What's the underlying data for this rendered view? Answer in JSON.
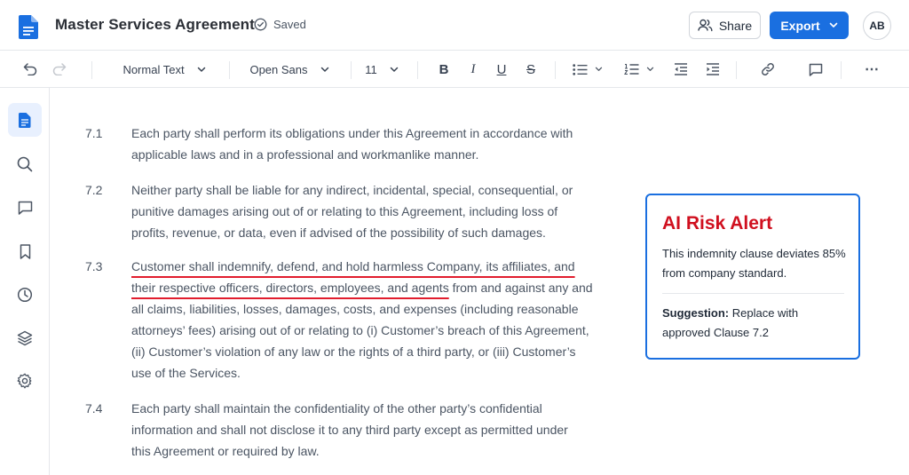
{
  "header": {
    "doc_title": "Master Services Agreement",
    "saved_label": "Saved",
    "share_label": "Share",
    "export_label": "Export",
    "avatar_initials": "AB"
  },
  "toolbar": {
    "style_select": "Normal Text",
    "font_select": "Open Sans",
    "size_select": "11",
    "bold": "B",
    "italic": "I",
    "underline": "U",
    "strike": "S",
    "more": "⋯"
  },
  "sidebar": {
    "items": [
      "document-icon",
      "search-icon",
      "comment-icon",
      "bookmark-icon",
      "history-icon",
      "layers-icon",
      "gear-icon"
    ]
  },
  "clauses": [
    {
      "number": "7.1",
      "lines": [
        "Each party shall perform its obligations under this Agreement in accordance with",
        "applicable laws and in a professional and workmanlike manner."
      ]
    },
    {
      "number": "7.2",
      "lines": [
        "Neither party shall be liable for any indirect, incidental, special, consequential, or",
        "punitive damages arising out of or relating to this Agreement, including loss of",
        "profits, revenue, or data, even if advised of the possibility of such damages."
      ]
    },
    {
      "number": "7.3",
      "flagged_line1": "Customer shall indemnify, defend, and hold harmless Company, its affiliates, and",
      "flagged_line2": "their respective officers, directors, employees, and agents",
      "line2_rest": " from and against any and",
      "lines": [
        "all claims, liabilities, losses, damages, costs, and expenses (including reasonable",
        "attorneys’ fees) arising out of or relating to (i) Customer’s breach of this Agreement,",
        "(ii) Customer’s violation of any law or the rights of a third party, or (iii) Customer’s",
        "use of the Services."
      ]
    },
    {
      "number": "7.4",
      "lines": [
        "Each party shall maintain the confidentiality of the other party’s confidential",
        "information and shall not disclose it to any third party except as permitted under",
        "this Agreement or required by law."
      ]
    }
  ],
  "alert": {
    "title": "AI Risk Alert",
    "message": "This indemnity clause deviates 85% from company standard.",
    "suggestion_label": "Suggestion:",
    "suggestion_text": " Replace with approved Clause 7.2",
    "accent_color": "#d0101f",
    "border_color": "#1a6fe0"
  }
}
